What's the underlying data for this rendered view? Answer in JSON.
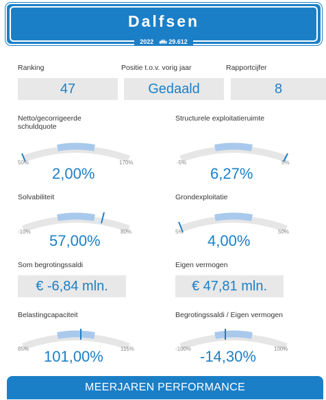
{
  "header": {
    "title": "Dalfsen",
    "year": "2022",
    "population_icon": "people-icon",
    "population": "29.612"
  },
  "top_stats": [
    {
      "label": "Ranking",
      "value": "47"
    },
    {
      "label": "Positie t.o.v. vorig jaar",
      "value": "Gedaald"
    },
    {
      "label": "Rapportcijfer",
      "value": "8"
    }
  ],
  "gauges": {
    "netto": {
      "title": "Netto/gecorrigeerde schuldquote",
      "min": "50%",
      "max": "170%",
      "value": "2,00%",
      "marker_fraction": 0.0
    },
    "structureel": {
      "title": "Structurele exploitatieruimte",
      "min": "-5%",
      "max": "5%",
      "value": "6,27%",
      "marker_fraction": 1.0
    },
    "solvabiliteit": {
      "title": "Solvabiliteit",
      "min": "-10%",
      "max": "80%",
      "value": "57,00%",
      "marker_fraction": 0.74
    },
    "grondexploitatie": {
      "title": "Grondexploitatie",
      "min": "5%",
      "max": "50%",
      "value": "4,00%",
      "marker_fraction": 0.0
    },
    "belasting": {
      "title": "Belastingcapaciteit",
      "min": "85%",
      "max": "115%",
      "value": "101,00%",
      "marker_fraction": 0.53
    },
    "begrotingssaldi_ev": {
      "title": "Begrotingssaldi / Eigen vermogen",
      "min": "-100%",
      "max": "100%",
      "value": "-14,30%",
      "marker_fraction": 0.43
    }
  },
  "boxes": {
    "som_label": "Som begrotingssaldi",
    "som_value": "€ -6,84 mln.",
    "ev_label": "Eigen vermogen",
    "ev_value": "€ 47,81 mln."
  },
  "footer": {
    "label": "MEERJAREN PERFORMANCE"
  },
  "colors": {
    "accent": "#1b7fc7",
    "band": "#a9c9ec",
    "track": "#e6e6e6"
  }
}
